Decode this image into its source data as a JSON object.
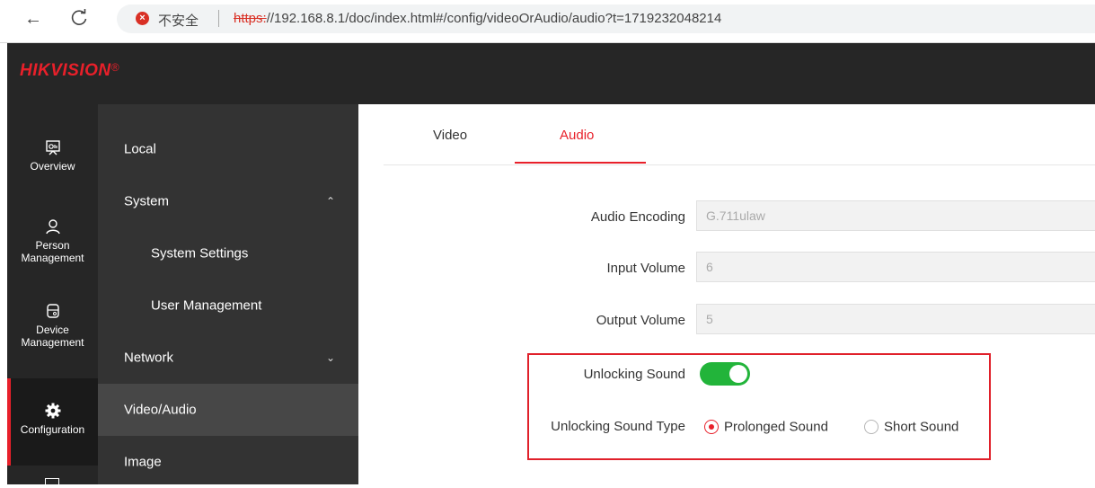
{
  "browser": {
    "back_icon": "arrow-left-icon",
    "reload_icon": "reload-icon",
    "security_label": "不安全",
    "url_scheme": "https:",
    "url_rest": "//192.168.8.1/doc/index.html#/config/videoOrAudio/audio?t=1719232048214"
  },
  "header": {
    "logo_hik": "HIK",
    "logo_vision": "VISION",
    "logo_reg": "®"
  },
  "rail": {
    "items": [
      {
        "label": "Overview",
        "icon": "overview-icon"
      },
      {
        "label": "Person Management",
        "icon": "person-icon"
      },
      {
        "label": "Device Management",
        "icon": "device-icon"
      },
      {
        "label": "Configuration",
        "icon": "gear-icon",
        "active": true
      }
    ]
  },
  "submenu": {
    "local": "Local",
    "system": "System",
    "system_settings": "System Settings",
    "user_management": "User Management",
    "network": "Network",
    "video_audio": "Video/Audio",
    "image": "Image"
  },
  "tabs": {
    "video": "Video",
    "audio": "Audio"
  },
  "form": {
    "audio_encoding_label": "Audio Encoding",
    "audio_encoding_value": "G.711ulaw",
    "input_volume_label": "Input Volume",
    "input_volume_value": "6",
    "output_volume_label": "Output Volume",
    "output_volume_value": "5",
    "unlocking_sound_label": "Unlocking Sound",
    "unlocking_sound_on": true,
    "unlocking_sound_type_label": "Unlocking Sound Type",
    "option_prolonged": "Prolonged Sound",
    "option_short": "Short Sound",
    "selected_option": "Prolonged Sound"
  },
  "colors": {
    "accent": "#e8202a",
    "toggle_on": "#22b43a",
    "header_bg": "#262626",
    "submenu_bg": "#333333"
  }
}
